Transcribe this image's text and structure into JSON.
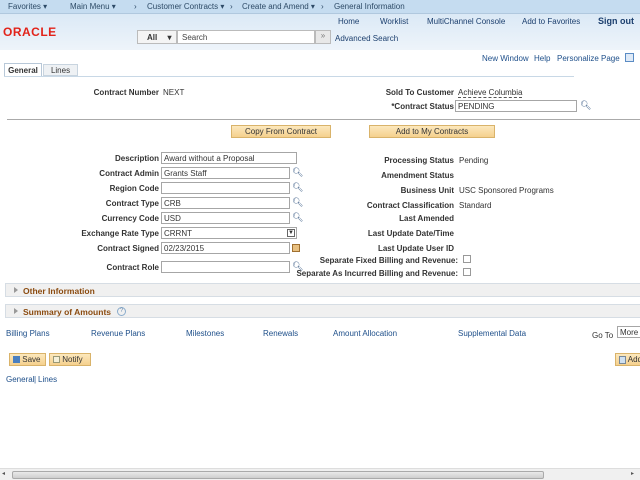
{
  "nav": {
    "favorites": "Favorites ▾",
    "main_menu": "Main Menu ▾",
    "breadcrumbs": [
      "Customer Contracts ▾",
      "Create and Amend ▾",
      "General Information"
    ],
    "sep": "›"
  },
  "header": {
    "logo": "ORACLE",
    "links": [
      "Home",
      "Worklist",
      "MultiChannel Console",
      "Add to Favorites"
    ],
    "sign_out": "Sign out",
    "search_scope": "All",
    "search_placeholder": "Search",
    "search_go": "»",
    "advanced_search": "Advanced Search"
  },
  "page_links": [
    "New Window",
    "Help",
    "Personalize Page"
  ],
  "tabs": [
    "General",
    "Lines"
  ],
  "contract_number": {
    "label": "Contract Number",
    "value": "NEXT"
  },
  "sold_to": {
    "label": "Sold To Customer",
    "value": "Achieve Columbia"
  },
  "contract_status": {
    "label": "*Contract Status",
    "value": "PENDING"
  },
  "buttons": {
    "copy": "Copy From Contract",
    "add_my": "Add to My Contracts",
    "save": "Save",
    "notify": "Notify",
    "add": "Add"
  },
  "left_fields": [
    {
      "label": "Description",
      "value": "Award without a Proposal"
    },
    {
      "label": "Contract Admin",
      "value": "Grants Staff"
    },
    {
      "label": "Region Code",
      "value": ""
    },
    {
      "label": "Contract Type",
      "value": "CRB"
    },
    {
      "label": "Currency Code",
      "value": "USD"
    },
    {
      "label": "Exchange Rate Type",
      "value": "CRRNT"
    },
    {
      "label": "Contract Signed",
      "value": "02/23/2015"
    },
    {
      "label": "Contract Role",
      "value": ""
    }
  ],
  "right_fields": [
    {
      "label": "Processing Status",
      "value": "Pending"
    },
    {
      "label": "Amendment Status",
      "value": ""
    },
    {
      "label": "Business Unit",
      "value": "USC Sponsored Programs"
    },
    {
      "label": "Contract Classification",
      "value": "Standard"
    },
    {
      "label": "Last Amended",
      "value": ""
    },
    {
      "label": "Last Update Date/Time",
      "value": ""
    },
    {
      "label": "Last Update User ID",
      "value": ""
    }
  ],
  "checkboxes": [
    {
      "label": "Separate Fixed Billing and Revenue:",
      "checked": false
    },
    {
      "label": "Separate As Incurred Billing and Revenue:",
      "checked": false
    }
  ],
  "sections": [
    "Other Information",
    "Summary of Amounts"
  ],
  "bottom_links": [
    "Billing Plans",
    "Revenue Plans",
    "Milestones",
    "Renewals",
    "Amount Allocation",
    "Supplemental Data"
  ],
  "goto": {
    "label": "Go To",
    "value": "More"
  },
  "footer_links": {
    "general": "General",
    "sep": "|",
    "lines": "Lines"
  }
}
